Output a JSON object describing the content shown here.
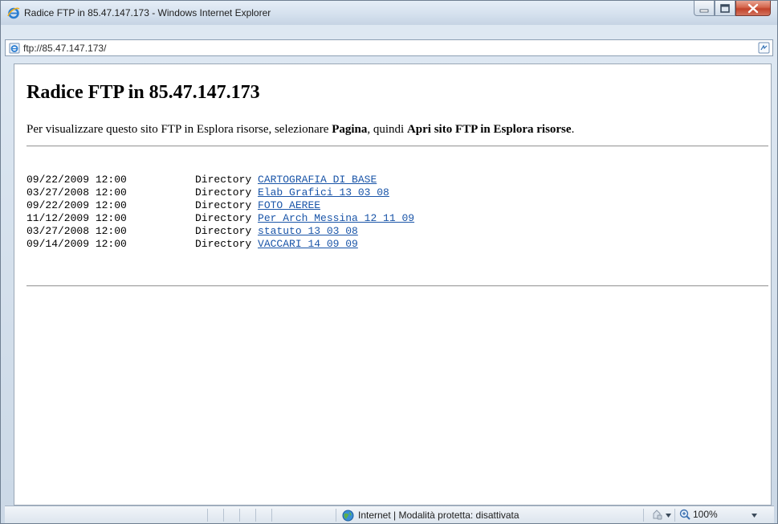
{
  "window": {
    "title": "Radice FTP in 85.47.147.173 - Windows Internet Explorer"
  },
  "address": {
    "url": "ftp://85.47.147.173/"
  },
  "page": {
    "heading": "Radice FTP in 85.47.147.173",
    "instructions": {
      "part1": "Per visualizzare questo sito FTP in Esplora risorse, selezionare ",
      "bold1": "Pagina",
      "part2": ", quindi ",
      "bold2": "Apri sito FTP in Esplora risorse",
      "part3": "."
    },
    "listing": [
      {
        "date": "09/22/2009 12:00",
        "kind": "Directory",
        "name": "CARTOGRAFIA DI BASE"
      },
      {
        "date": "03/27/2008 12:00",
        "kind": "Directory",
        "name": "Elab Grafici 13 03 08"
      },
      {
        "date": "09/22/2009 12:00",
        "kind": "Directory",
        "name": "FOTO AEREE"
      },
      {
        "date": "11/12/2009 12:00",
        "kind": "Directory",
        "name": "Per Arch_Messina_12_11_09"
      },
      {
        "date": "03/27/2008 12:00",
        "kind": "Directory",
        "name": "statuto 13 03 08"
      },
      {
        "date": "09/14/2009 12:00",
        "kind": "Directory",
        "name": "VACCARI 14 09 09"
      }
    ]
  },
  "status": {
    "zone": "Internet | Modalità protetta: disattivata",
    "zoom": "100%"
  },
  "colors": {
    "link": "#1a55a8",
    "close_button": "#c2432a"
  },
  "icons": [
    "ie-logo-icon",
    "page-icon",
    "compatibility-icon",
    "minimize-icon",
    "maximize-icon",
    "close-icon",
    "globe-icon",
    "security-icon",
    "zoom-icon",
    "chevron-down-icon"
  ]
}
